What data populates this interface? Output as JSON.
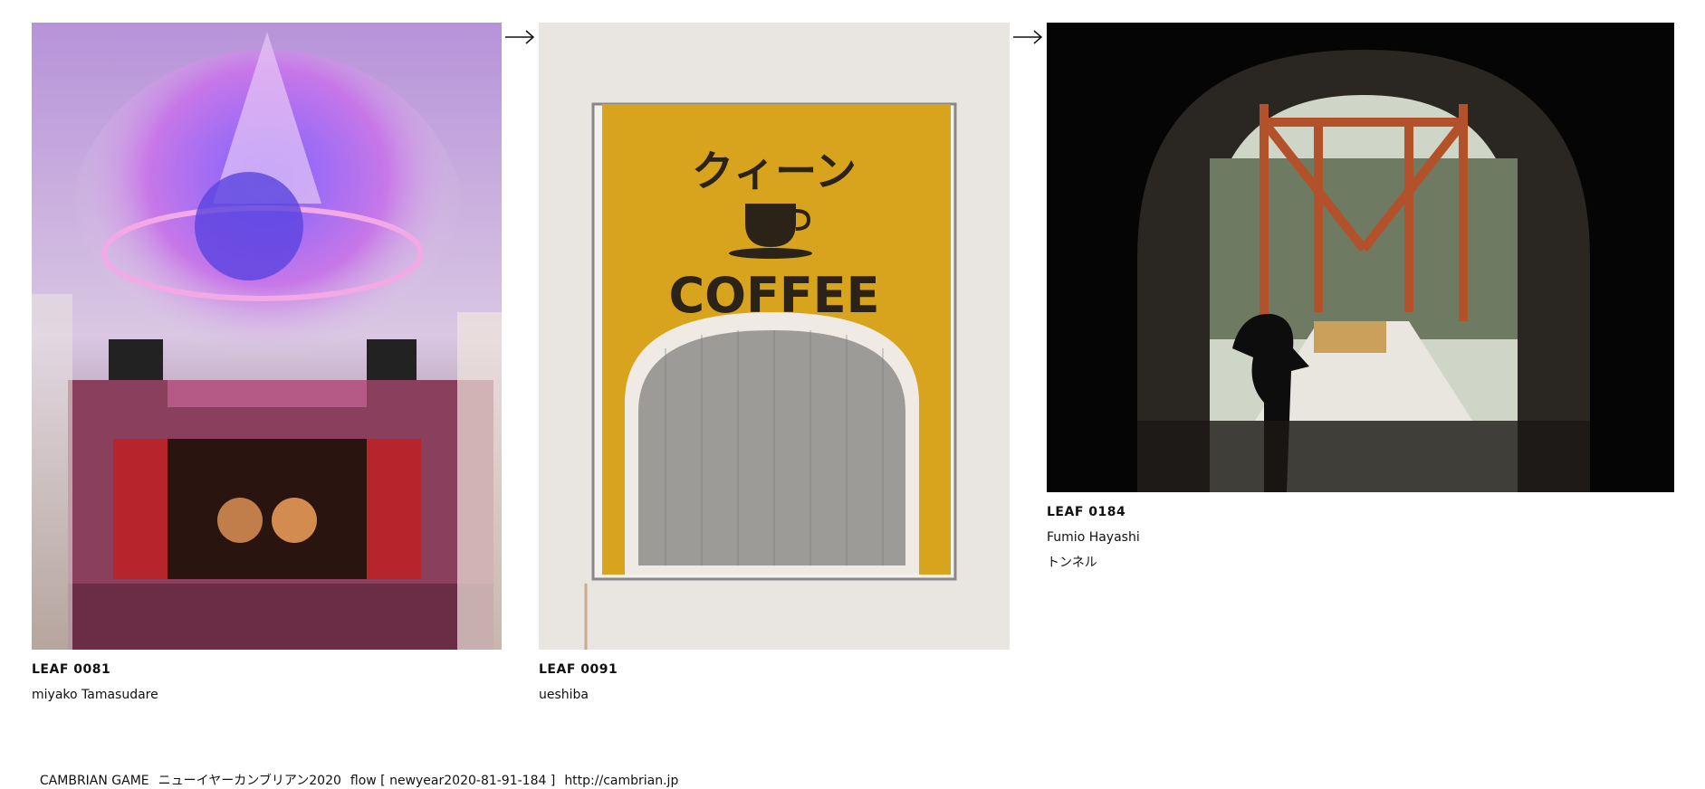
{
  "leaves": [
    {
      "code": "LEAF 0081",
      "author": "miyako Tamasudare",
      "title": "",
      "image": "theater-chandelier-photo"
    },
    {
      "code": "LEAF 0091",
      "author": "ueshiba",
      "title": "",
      "image": "queen-coffee-sign-photo",
      "sign_top": "クィーン",
      "sign_bottom": "COFFEE"
    },
    {
      "code": "LEAF 0184",
      "author": "Fumio Hayashi",
      "title": "トンネル",
      "image": "tunnel-bridge-photo"
    }
  ],
  "arrows": [
    "→",
    "→"
  ],
  "footer": {
    "brand": "CAMBRIAN GAME",
    "event": "ニューイヤーカンブリアン2020",
    "flow": "flow [ newyear2020-81-91-184 ]",
    "url": "http://cambrian.jp"
  },
  "colors": {
    "text": "#111111",
    "background": "#ffffff",
    "sign_yellow": "#d8a41e"
  }
}
